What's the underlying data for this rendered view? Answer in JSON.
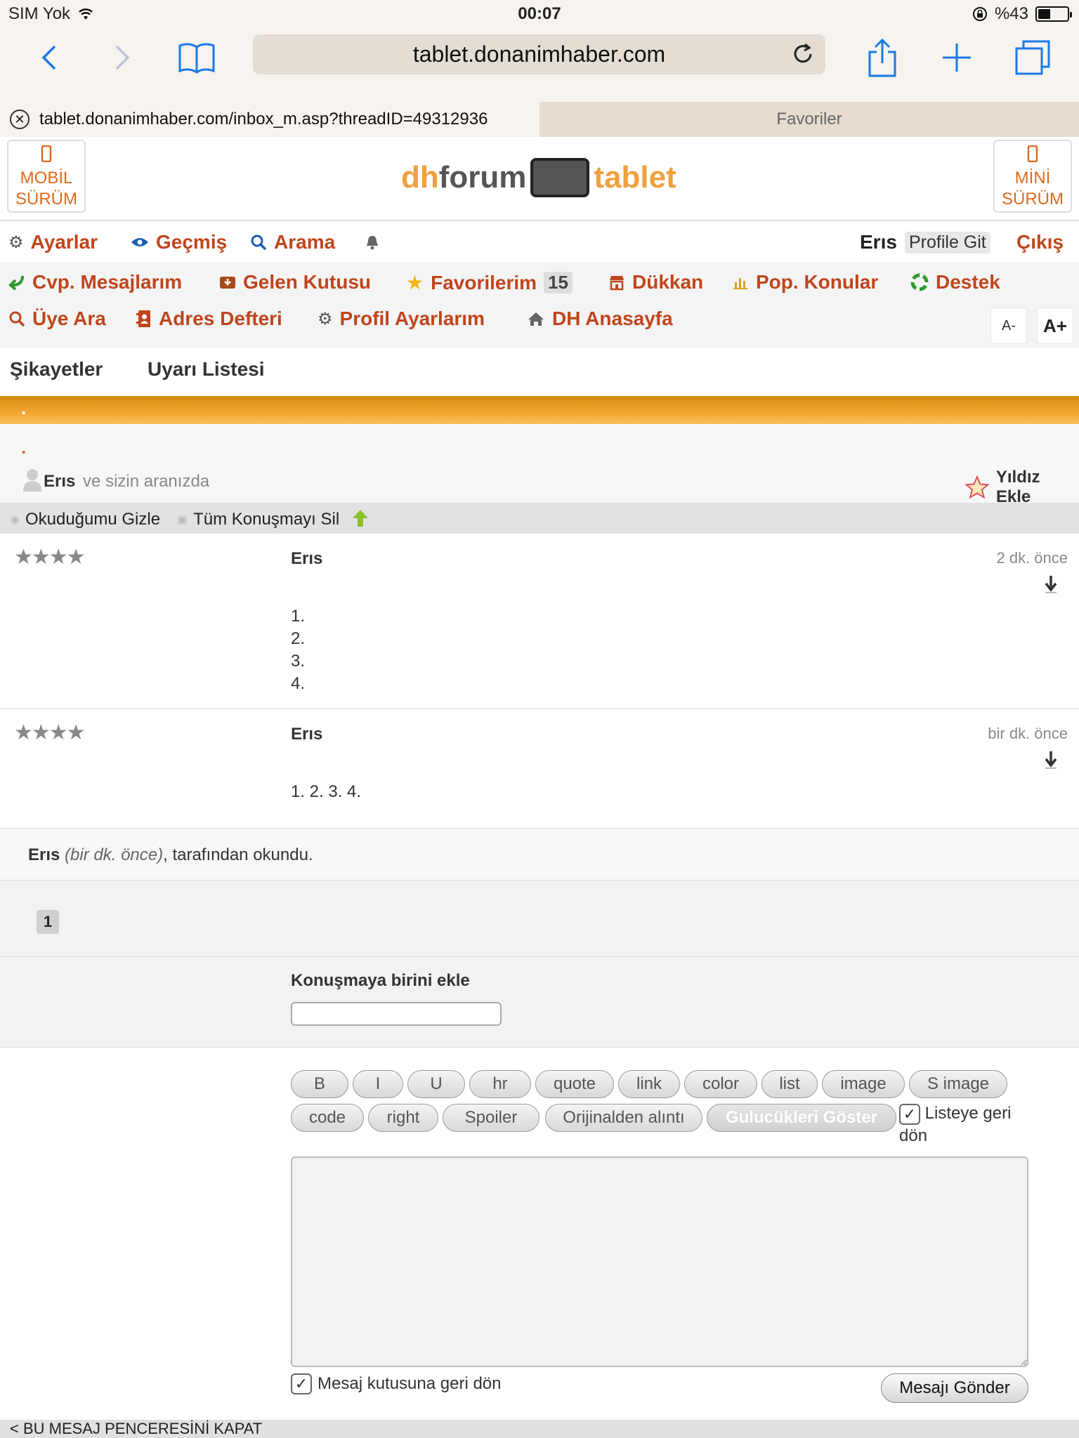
{
  "status": {
    "carrier": "SIM Yok",
    "time": "00:07",
    "battery": "%43",
    "battery_level": 0.43
  },
  "browser": {
    "url": "tablet.donanimhaber.com",
    "tab_active": "tablet.donanimhaber.com/inbox_m.asp?threadID=49312936",
    "tab_inactive": "Favoriler"
  },
  "header": {
    "left_btn_line1": "MOBİL",
    "left_btn_line2": "SÜRÜM",
    "right_btn_line1": "MİNİ",
    "right_btn_line2": "SÜRÜM",
    "logo_dh": "dh",
    "logo_forum": "forum",
    "logo_tab": "tablet"
  },
  "nav": {
    "settings": "Ayarlar",
    "history": "Geçmiş",
    "search": "Arama",
    "user": "Erıs",
    "profile": "Profile Git",
    "logout": "Çıkış",
    "replies": "Cvp. Mesajlarım",
    "inbox": "Gelen Kutusu",
    "favorites": "Favorilerim",
    "favorites_count": "15",
    "shop": "Dükkan",
    "popular": "Pop. Konular",
    "support": "Destek",
    "member_search": "Üye Ara",
    "address_book": "Adres Defteri",
    "profile_settings": "Profil Ayarlarım",
    "home": "DH Anasayfa",
    "font_minus": "A-",
    "font_plus": "A+",
    "complaints": "Şikayetler",
    "warnings": "Uyarı Listesi"
  },
  "thread": {
    "dot1": ".",
    "dot2": ".",
    "participant": "Erıs",
    "participants_suffix": "ve sizin aranızda",
    "star_add": "Yıldız Ekle",
    "hide_read": "Okuduğumu Gizle",
    "delete_all": "Tüm Konuşmayı Sil"
  },
  "messages": [
    {
      "stars": "★★★★",
      "author": "Erıs",
      "time": "2 dk. önce",
      "lines": [
        "1.",
        "2.",
        "3.",
        "4."
      ]
    },
    {
      "stars": "★★★★",
      "author": "Erıs",
      "time": "bir dk. önce",
      "lines": [
        "1. 2. 3. 4."
      ]
    }
  ],
  "readby": {
    "name": "Erıs",
    "when": "(bir dk. önce)",
    "suffix": ", tarafından okundu."
  },
  "pager": {
    "page": "1"
  },
  "add_person": {
    "label": "Konuşmaya birini ekle",
    "value": ""
  },
  "editor": {
    "row1": [
      "B",
      "I",
      "U",
      "hr",
      "quote",
      "link",
      "color",
      "list",
      "image",
      "S image"
    ],
    "row2": [
      "code",
      "right",
      "Spoiler",
      "Orijinalden alıntı",
      "Gulucükleri Göster"
    ],
    "back_to_list": "Listeye geri dön",
    "back_to_inbox": "Mesaj kutusuna geri dön",
    "send": "Mesajı Gönder",
    "message": ""
  },
  "footer": {
    "close": "< BU MESAJ PENCERESİNİ KAPAT"
  },
  "colors": {
    "accent": "#c0451c",
    "orange": "#f2a832",
    "ios_blue": "#1a7ae6"
  }
}
